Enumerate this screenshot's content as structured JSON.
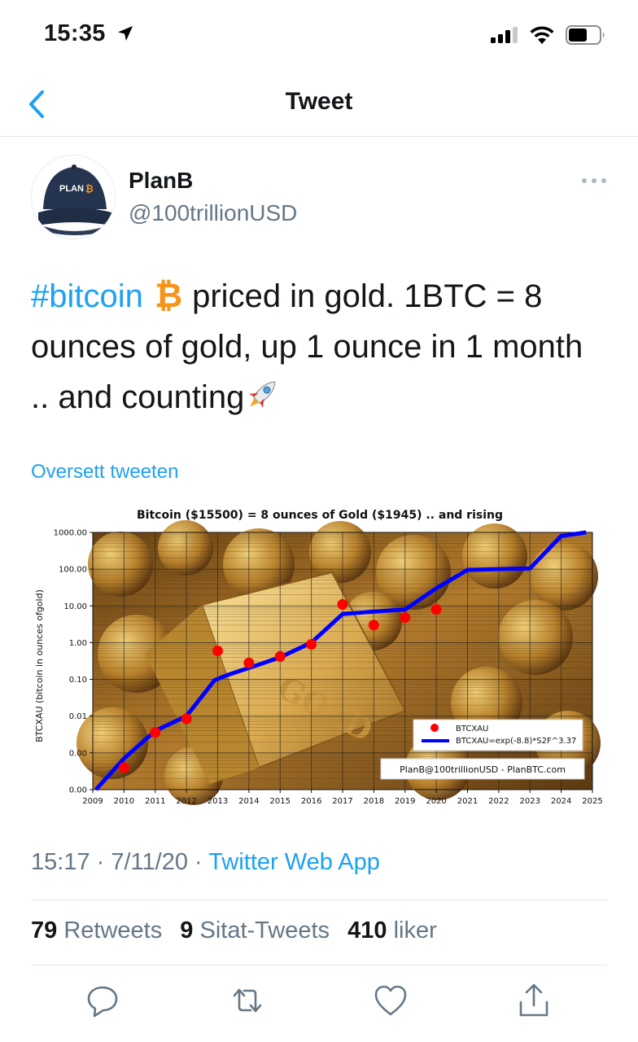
{
  "status": {
    "time": "15:35"
  },
  "nav": {
    "title": "Tweet"
  },
  "author": {
    "name": "PlanB",
    "handle": "@100trillionUSD",
    "avatar_text": "PLAN"
  },
  "tweet": {
    "hashtag": "#bitcoin",
    "text_1": " priced in gold. 1BTC = 8 ounces of gold, up 1 ounce in 1 month .. and counting",
    "translate": "Oversett tweeten",
    "time": "15:17",
    "sep": "·",
    "date": "7/11/20",
    "source": "Twitter Web App"
  },
  "stats": {
    "retweets_count": "79",
    "retweets_label": "Retweets",
    "quotes_count": "9",
    "quotes_label": "Sitat-Tweets",
    "likes_count": "410",
    "likes_label": "liker"
  },
  "colors": {
    "accent": "#1da1f2",
    "muted": "#657786",
    "bitcoin": "#f7931a",
    "series_line": "#0000ff",
    "series_points": "#ff0000"
  },
  "icons": [
    "back-chevron-icon",
    "more-icon",
    "bitcoin-icon",
    "rocket-icon",
    "reply-icon",
    "retweet-icon",
    "like-icon",
    "share-icon"
  ],
  "chart_data": {
    "type": "line",
    "title": "Bitcoin ($15500) = 8 ounces of Gold ($1945) .. and rising",
    "ylabel": "BTCXAU (bitcoin in ounces ofgold)",
    "xlabel": "",
    "y_scale": "log",
    "ylim": [
      0.0001,
      1000
    ],
    "xlim": [
      2009,
      2025
    ],
    "grid": true,
    "x_ticks": [
      "2009",
      "2010",
      "2011",
      "2012",
      "2013",
      "2014",
      "2015",
      "2016",
      "2017",
      "2018",
      "2019",
      "2020",
      "2021",
      "2022",
      "2023",
      "2024",
      "2025"
    ],
    "y_ticks": [
      {
        "value": 0.0001,
        "label": "0.00"
      },
      {
        "value": 0.001,
        "label": "0.00"
      },
      {
        "value": 0.01,
        "label": "0.01"
      },
      {
        "value": 0.1,
        "label": "0.10"
      },
      {
        "value": 1,
        "label": "1.00"
      },
      {
        "value": 10,
        "label": "10.00"
      },
      {
        "value": 100,
        "label": "100.00"
      },
      {
        "value": 1000,
        "label": "1000.00"
      }
    ],
    "legend_position": "bottom-right",
    "annotation": "PlanB@100trillionUSD  -  PlanBTC.com",
    "series": [
      {
        "name": "BTCXAU",
        "type": "scatter",
        "x": [
          2010,
          2011,
          2012,
          2013,
          2014,
          2015,
          2016,
          2017,
          2018,
          2019,
          2020
        ],
        "y": [
          0.0004,
          0.0036,
          0.0085,
          0.6,
          0.28,
          0.42,
          0.9,
          11,
          3,
          4.8,
          8
        ]
      },
      {
        "name": "BTCXAU=exp(-8.8)*S2F^3.37",
        "type": "line",
        "x": [
          2009.1,
          2010,
          2011,
          2012,
          2012.9,
          2013.3,
          2014.3,
          2015,
          2016,
          2017,
          2018,
          2019,
          2020,
          2021,
          2022,
          2023,
          2024,
          2024.8
        ],
        "y": [
          0.0001,
          0.0007,
          0.004,
          0.01,
          0.095,
          0.13,
          0.25,
          0.4,
          1.0,
          6,
          7,
          8,
          30,
          95,
          100,
          105,
          800,
          1000
        ]
      }
    ]
  }
}
